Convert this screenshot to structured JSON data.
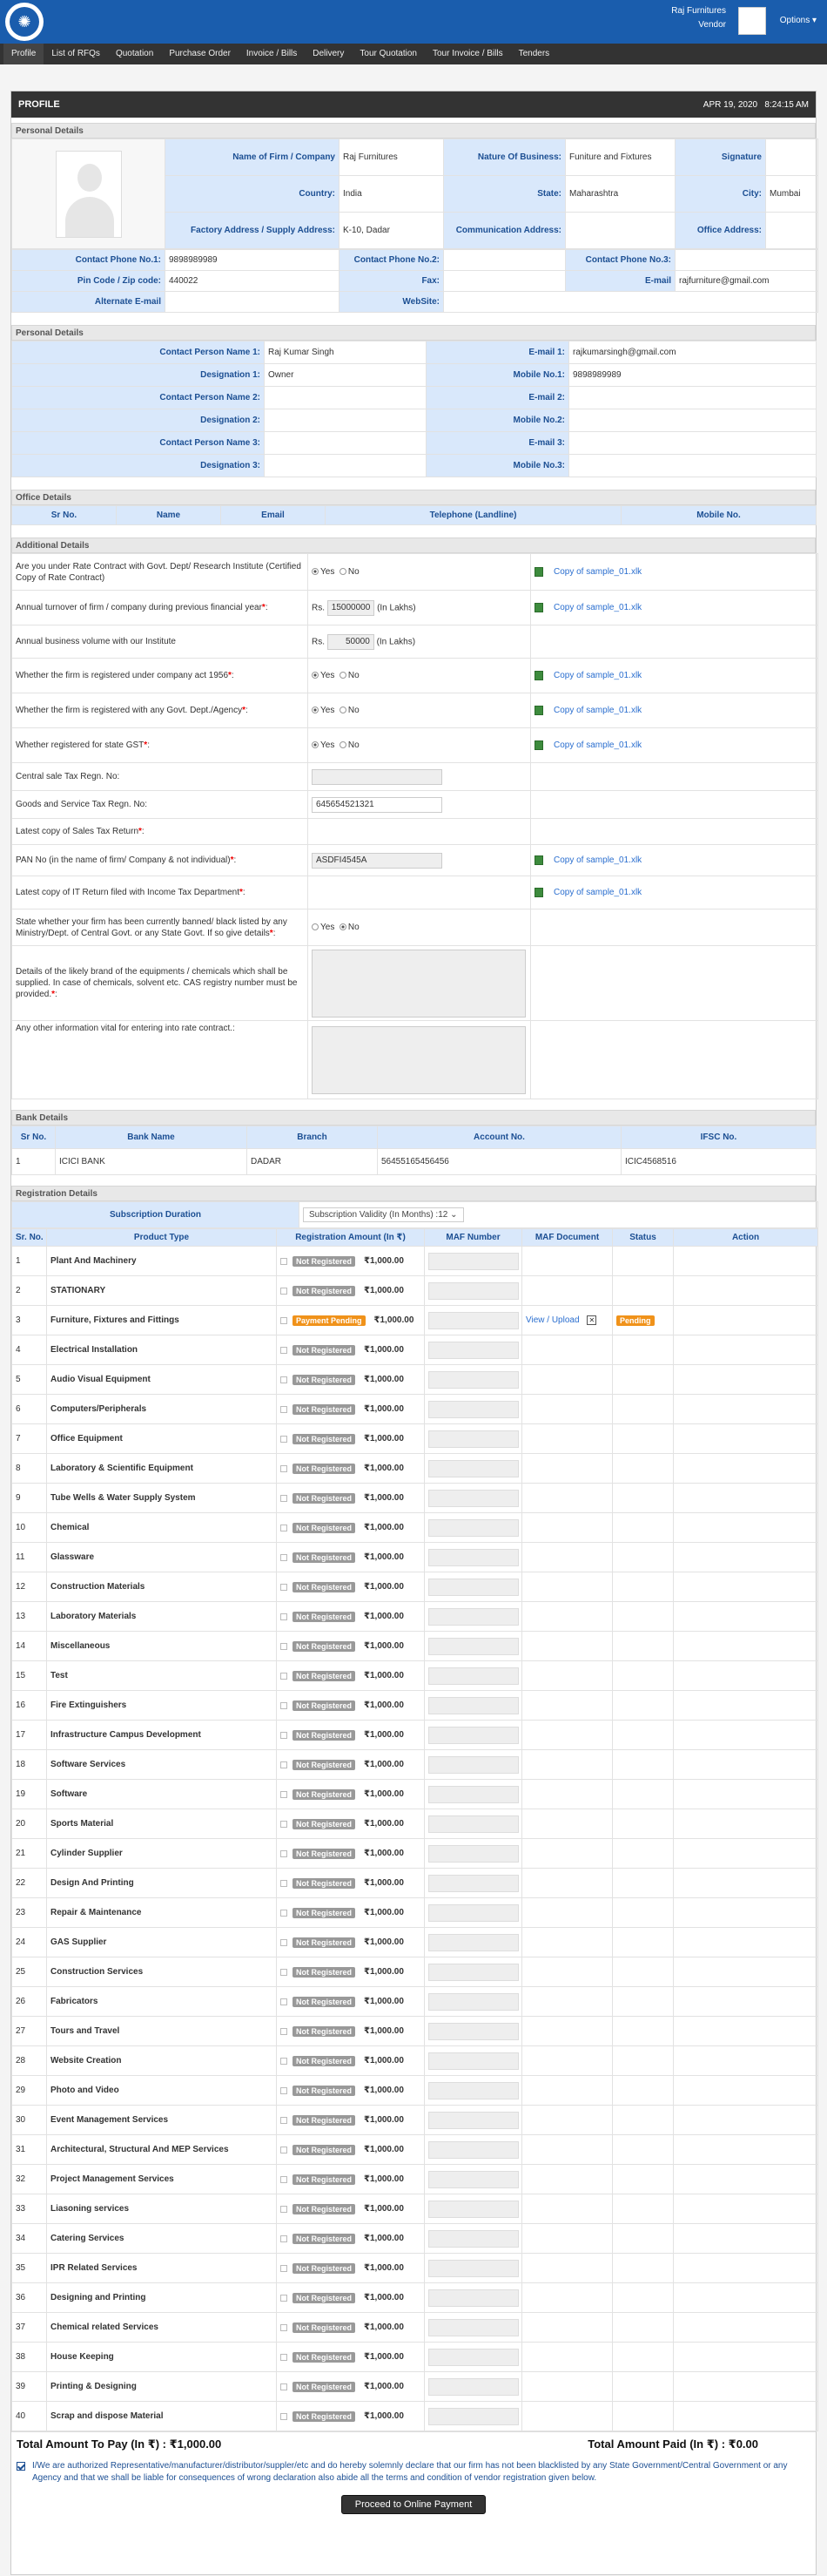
{
  "header": {
    "user_name": "Raj Furnitures",
    "user_role": "Vendor",
    "options_label": "Options ▾"
  },
  "nav": [
    "Profile",
    "List of RFQs",
    "Quotation",
    "Purchase Order",
    "Invoice / Bills",
    "Delivery",
    "Tour Quotation",
    "Tour Invoice / Bills",
    "Tenders"
  ],
  "profile": {
    "title": "PROFILE",
    "date": "APR 19, 2020",
    "time": "8:24:15 AM"
  },
  "personal": {
    "section_title": "Personal Details",
    "firm_label": "Name of Firm / Company",
    "firm": "Raj Furnitures",
    "business_label": "Nature Of Business:",
    "business": "Funiture and Fixtures",
    "signature_label": "Signature",
    "country_label": "Country:",
    "country": "India",
    "state_label": "State:",
    "state": "Maharashtra",
    "city_label": "City:",
    "city": "Mumbai",
    "factory_label": "Factory Address / Supply Address:",
    "factory": "K-10, Dadar",
    "comm_label": "Communication Address:",
    "comm": "",
    "office_label": "Office Address:",
    "office": "",
    "phone1_label": "Contact Phone No.1:",
    "phone1": "9898989989",
    "phone2_label": "Contact Phone No.2:",
    "phone2": "",
    "phone3_label": "Contact Phone No.3:",
    "phone3": "",
    "pin_label": "Pin Code / Zip code:",
    "pin": "440022",
    "fax_label": "Fax:",
    "fax": "",
    "email_label": "E-mail",
    "email": "rajfurniture@gmail.com",
    "alt_email_label": "Alternate E-mail",
    "alt_email": "",
    "website_label": "WebSite:",
    "website": ""
  },
  "contacts": {
    "section_title": "Personal Details",
    "rows": [
      {
        "l1": "Contact Person Name 1:",
        "v1": "Raj Kumar Singh",
        "l2": "E-mail 1:",
        "v2": "rajkumarsingh@gmail.com"
      },
      {
        "l1": "Designation 1:",
        "v1": "Owner",
        "l2": "Mobile No.1:",
        "v2": "9898989989"
      },
      {
        "l1": "Contact Person Name 2:",
        "v1": "",
        "l2": "E-mail 2:",
        "v2": ""
      },
      {
        "l1": "Designation 2:",
        "v1": "",
        "l2": "Mobile No.2:",
        "v2": ""
      },
      {
        "l1": "Contact Person Name 3:",
        "v1": "",
        "l2": "E-mail 3:",
        "v2": ""
      },
      {
        "l1": "Designation 3:",
        "v1": "",
        "l2": "Mobile No.3:",
        "v2": ""
      }
    ]
  },
  "office": {
    "section_title": "Office Details",
    "headers": [
      "Sr No.",
      "Name",
      "Email",
      "Telephone (Landline)",
      "Mobile No."
    ]
  },
  "additional": {
    "section_title": "Additional Details",
    "yes": "Yes",
    "no": "No",
    "file_name": "Copy of sample_01.xlk",
    "rs": "Rs.",
    "lakhs": "(In Lakhs)",
    "q_rate_contract": "Are you under Rate Contract with Govt. Dept/ Research Institute (Certified Copy of Rate Contract)",
    "q_turnover": "Annual turnover of firm / company during previous financial year",
    "turnover": "15000000",
    "q_volume": "Annual business volume with our Institute",
    "volume": "50000",
    "q_company_act": "Whether the firm is registered under company act 1956",
    "q_govt_dept": "Whether the firm is registered with any Govt. Dept./Agency",
    "q_gst": "Whether registered for state GST",
    "q_cst": "Central sale Tax Regn. No:",
    "q_gstno": "Goods and Service Tax Regn. No:",
    "gst_no": "645654521321",
    "q_sales_tax": "Latest copy of Sales Tax Return",
    "q_pan": "PAN No (in the name of firm/ Company & not individual)",
    "pan": "ASDFI4545A",
    "q_it": "Latest copy of IT Return filed with Income Tax Department",
    "q_banned": "State whether your firm has been currently banned/ black listed by any Ministry/Dept. of Central Govt. or any State Govt. If so give details",
    "q_brands": "Details of the likely brand of the equipments / chemicals which shall be supplied. In case of chemicals, solvent etc. CAS registry number must be provided.",
    "q_other": "Any other information vital for entering into rate contract.:"
  },
  "bank": {
    "section_title": "Bank Details",
    "headers": [
      "Sr No.",
      "Bank Name",
      "Branch",
      "Account No.",
      "IFSC No."
    ],
    "rows": [
      [
        "1",
        "ICICI BANK",
        "DADAR",
        "56455165456456",
        "ICIC4568516"
      ]
    ]
  },
  "registration": {
    "section_title": "Registration Details",
    "subscription_label": "Subscription Duration",
    "subscription_value": "Subscription Validity (In Months) :12",
    "headers": [
      "Sr. No.",
      "Product Type",
      "Registration Amount (In ₹)",
      "MAF Number",
      "MAF Document",
      "Status",
      "Action"
    ],
    "not_registered": "Not Registered",
    "payment_pending": "Payment Pending",
    "pending": "Pending",
    "view_upload": "View / Upload",
    "amount": "₹1,000.00",
    "products": [
      "Plant And Machinery",
      "STATIONARY",
      "Furniture, Fixtures and Fittings",
      "Electrical Installation",
      "Audio Visual Equipment",
      "Computers/Peripherals",
      "Office Equipment",
      "Laboratory & Scientific Equipment",
      "Tube Wells & Water Supply System",
      "Chemical",
      "Glassware",
      "Construction Materials",
      "Laboratory Materials",
      "Miscellaneous",
      "Test",
      "Fire Extinguishers",
      "Infrastructure Campus Development",
      "Software Services",
      "Software",
      "Sports Material",
      "Cylinder Supplier",
      "Design And Printing",
      "Repair & Maintenance",
      "GAS Supplier",
      "Construction Services",
      "Fabricators",
      "Tours and Travel",
      "Website Creation",
      "Photo and Video",
      "Event Management Services",
      "Architectural, Structural And MEP Services",
      "Project Management Services",
      "Liasoning services",
      "Catering Services",
      "IPR Related Services",
      "Designing and Printing",
      "Chemical related Services",
      "House Keeping",
      "Printing & Designing",
      "Scrap and dispose Material"
    ],
    "pending_index": 3
  },
  "totals": {
    "to_pay": "Total Amount To Pay (In ₹)  :  ₹1,000.00",
    "paid": "Total Amount Paid (In ₹)  :  ₹0.00"
  },
  "declaration": "I/We are authorized Representative/manufacturer/distributor/suppler/etc and do hereby solemnly declare that our firm has not been blacklisted by any State Government/Central Government or any Agency and that we shall be liable for consequences of wrong declaration also abide all the terms and condition of vendor registration given below.",
  "pay_button": "Proceed to Online Payment"
}
